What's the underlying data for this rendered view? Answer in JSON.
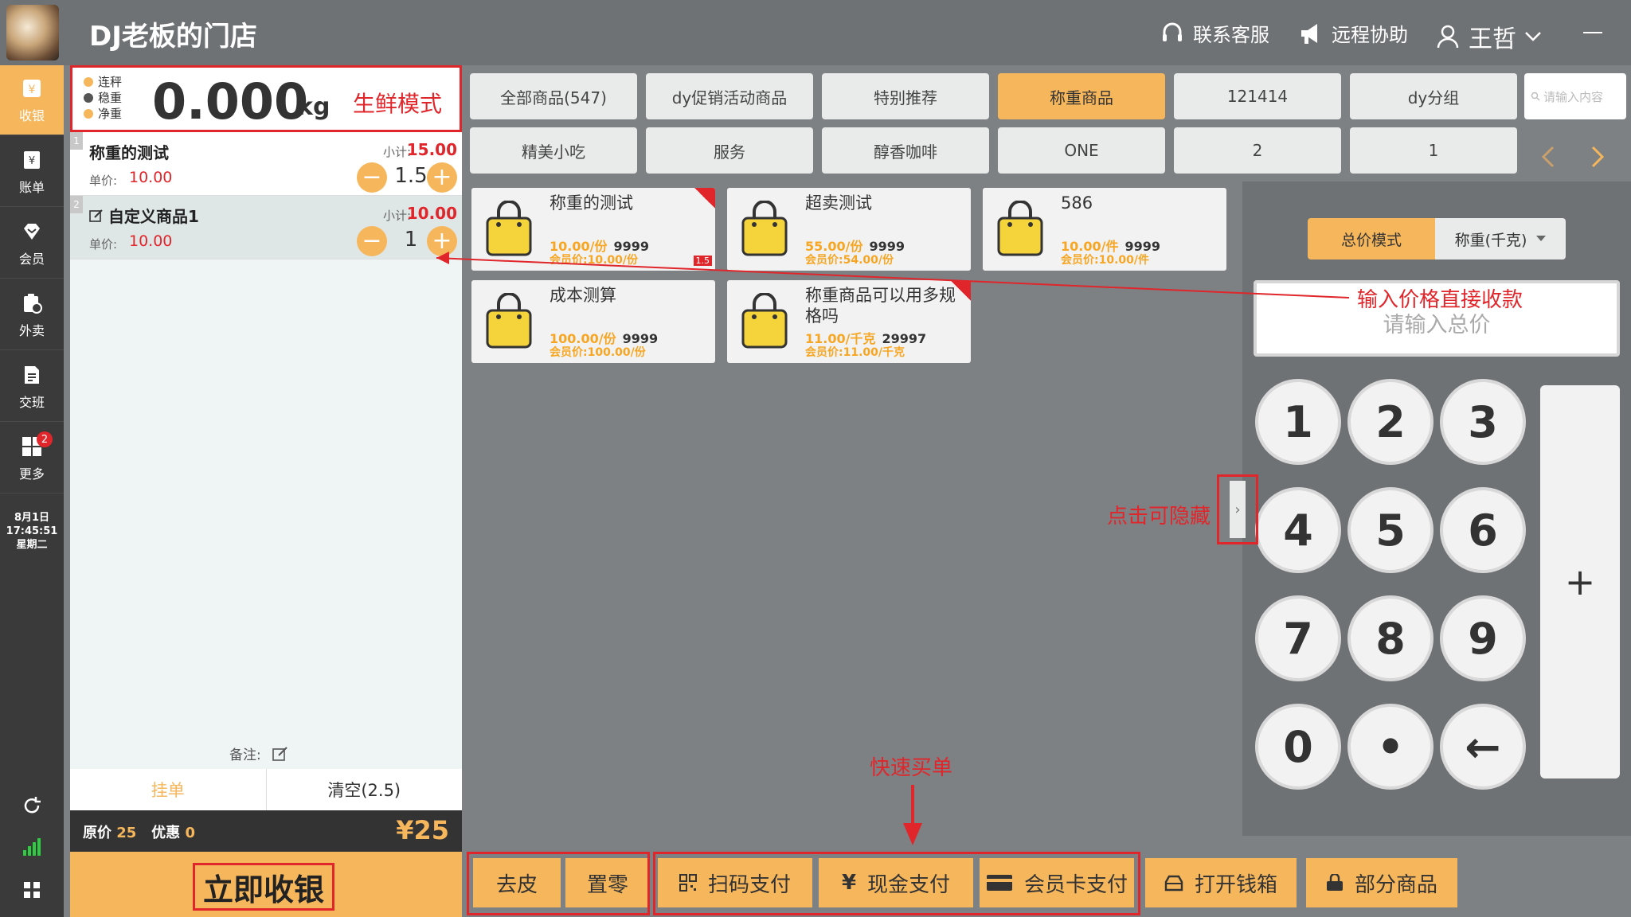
{
  "header": {
    "store_name": "DJ老板的门店",
    "support_label": "联系客服",
    "remote_label": "远程协助",
    "user_name": "王哲"
  },
  "sidebar": {
    "items": [
      {
        "label": "收银",
        "icon": "cashier-icon"
      },
      {
        "label": "账单",
        "icon": "bill-icon"
      },
      {
        "label": "会员",
        "icon": "member-icon"
      },
      {
        "label": "外卖",
        "icon": "takeout-icon"
      },
      {
        "label": "交班",
        "icon": "shift-icon"
      },
      {
        "label": "更多",
        "icon": "more-icon"
      }
    ],
    "more_badge": "2",
    "date": "8月1日",
    "time": "17:45:51",
    "weekday": "星期二"
  },
  "scale": {
    "status": [
      "连秤",
      "稳重",
      "净重"
    ],
    "status_colors": [
      "#f6b65c",
      "#555555",
      "#f6b65c"
    ],
    "value": "0.000",
    "unit": "kg",
    "mode": "生鲜模式"
  },
  "order": {
    "subtotal_label": "小计:",
    "unit_price_label": "单价:",
    "items": [
      {
        "num": "1",
        "name": "称重的测试",
        "subtotal": "15.00",
        "unit_price": "10.00",
        "qty": "1.5"
      },
      {
        "num": "2",
        "name": "自定义商品1",
        "subtotal": "10.00",
        "unit_price": "10.00",
        "qty": "1"
      }
    ],
    "remark_label": "备注:",
    "hold_label": "挂单",
    "clear_label": "清空(2.5)",
    "original_label": "原价",
    "original_value": "25",
    "discount_label": "优惠",
    "discount_value": "0",
    "total": "¥25",
    "checkout_label": "立即收银"
  },
  "categories": {
    "row1": [
      "全部商品(547)",
      "dy促销活动商品",
      "特别推荐",
      "称重商品",
      "121414",
      "dy分组"
    ],
    "row2": [
      "精美小吃",
      "服务",
      "醇香咖啡",
      "ONE",
      "2",
      "1"
    ],
    "active": "称重商品",
    "search_placeholder": "请输入内容"
  },
  "products": [
    {
      "name": "称重的测试",
      "price": "10.00/份",
      "stock": "9999",
      "member": "会员价:10.00/份",
      "tag": "1.5"
    },
    {
      "name": "超卖测试",
      "price": "55.00/份",
      "stock": "9999",
      "member": "会员价:54.00/份"
    },
    {
      "name": "586",
      "price": "10.00/件",
      "stock": "9999",
      "member": "会员价:10.00/件"
    },
    {
      "name": "成本测算",
      "price": "100.00/份",
      "stock": "9999",
      "member": "会员价:100.00/份"
    },
    {
      "name": "称重商品可以用多规格吗",
      "price": "11.00/千克",
      "stock": "29997",
      "member": "会员价:11.00/千克"
    }
  ],
  "keypad": {
    "mode_total": "总价模式",
    "mode_weight": "称重(千克)",
    "input_placeholder": "请输入总价",
    "keys": [
      "1",
      "2",
      "3",
      "4",
      "5",
      "6",
      "7",
      "8",
      "9",
      "0",
      "•",
      "←"
    ],
    "plus": "+"
  },
  "actions": {
    "tare": "去皮",
    "zero": "置零",
    "scan_pay": "扫码支付",
    "cash_pay": "现金支付",
    "card_pay": "会员卡支付",
    "open_drawer": "打开钱箱",
    "partial": "部分商品"
  },
  "annotations": {
    "direct_pay": "输入价格直接收款",
    "hide_hint": "点击可隐藏",
    "quick_checkout": "快速买单"
  },
  "colors": {
    "accent": "#f6b65c",
    "price": "#e0262b",
    "annotation": "#e0262b"
  }
}
